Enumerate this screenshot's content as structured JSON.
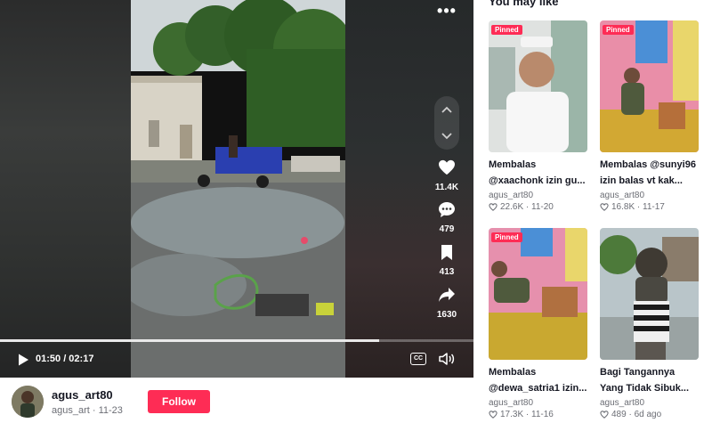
{
  "player": {
    "stats": {
      "likes": "11.4K",
      "comments": "479",
      "saves": "413",
      "shares": "1630"
    },
    "time": "01:50 / 02:17",
    "progress": 0.8,
    "captions_label": "CC"
  },
  "author": {
    "username": "agus_art80",
    "subline": "agus_art · 11-23",
    "follow_label": "Follow"
  },
  "recommendations": {
    "title": "You may like",
    "items": [
      {
        "pinned": "Pinned",
        "title_line1": "Membalas",
        "title_line2": "@xaachonk izin gu...",
        "author": "agus_art80",
        "stats": "22.6K · 11-20"
      },
      {
        "pinned": "Pinned",
        "title_line1": "Membalas @sunyi96",
        "title_line2": "izin balas vt kak...",
        "author": "agus_art80",
        "stats": "16.8K · 11-17"
      },
      {
        "pinned": "Pinned",
        "title_line1": "Membalas",
        "title_line2": "@dewa_satria1 izin...",
        "author": "agus_art80",
        "stats": "17.3K · 11-16"
      },
      {
        "title_line1": "Bagi Tangannya",
        "title_line2": "Yang Tidak Sibuk...",
        "author": "agus_art80",
        "stats": "489 · 6d ago"
      }
    ]
  },
  "colors": {
    "accent": "#fe2c55",
    "text": "#161823",
    "muted": "#6c6e75"
  },
  "icons": {
    "more": "more-dots-icon",
    "up": "chevron-up-icon",
    "down": "chevron-down-icon",
    "like": "heart-icon",
    "comment": "comment-icon",
    "save": "bookmark-icon",
    "share": "share-arrow-icon",
    "play": "play-icon",
    "captions": "captions-icon",
    "volume": "volume-icon"
  }
}
